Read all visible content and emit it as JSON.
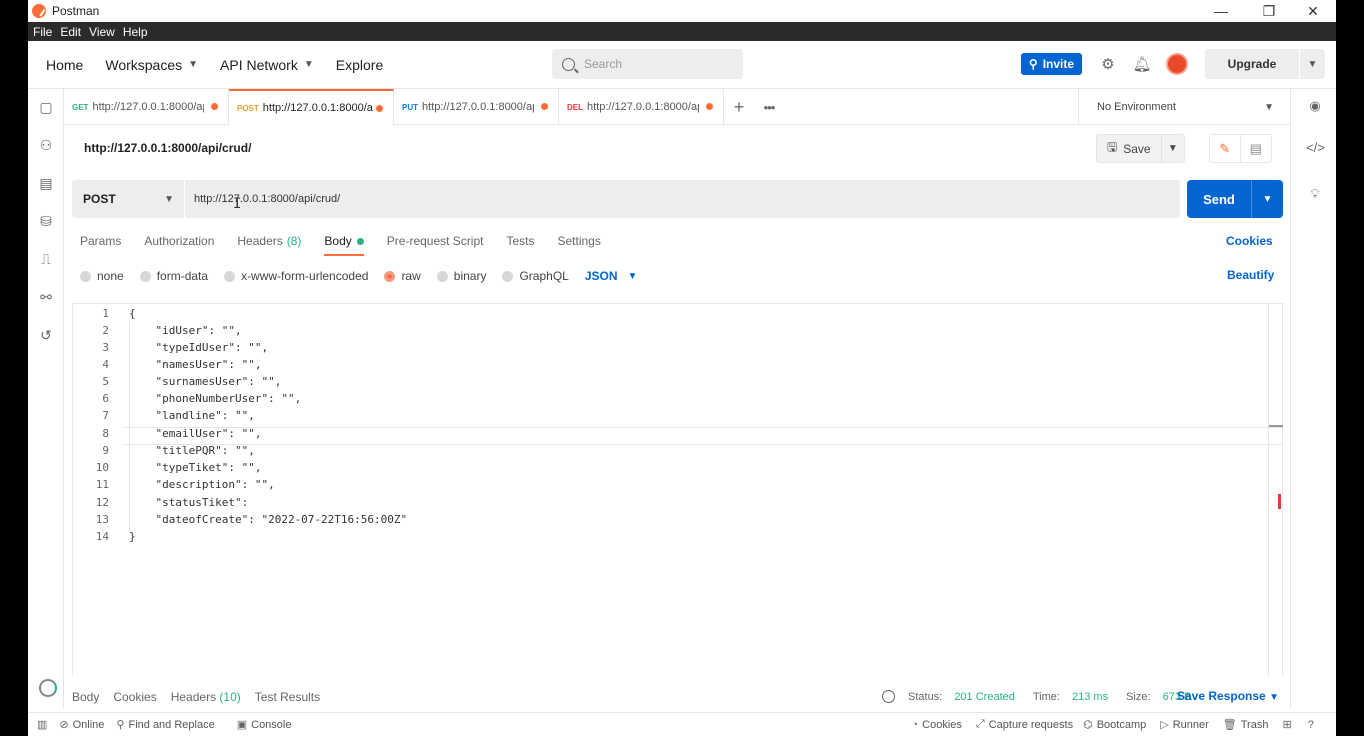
{
  "window": {
    "title": "Postman",
    "controls": {
      "minimize": "—",
      "restore": "❐",
      "close": "✕"
    }
  },
  "menu": [
    "File",
    "Edit",
    "View",
    "Help"
  ],
  "header": {
    "home": "Home",
    "workspaces": "Workspaces",
    "api_network": "API Network",
    "explore": "Explore",
    "search_placeholder": "Search",
    "invite": "Invite",
    "upgrade": "Upgrade"
  },
  "tabs": [
    {
      "method": "GET",
      "url": "http://127.0.0.1:8000/ap",
      "method_color": "#26b47f",
      "active": false
    },
    {
      "method": "POST",
      "url": "http://127.0.0.1:8000/a",
      "method_color": "#f0a030",
      "active": true
    },
    {
      "method": "PUT",
      "url": "http://127.0.0.1:8000/ap",
      "method_color": "#097bed",
      "active": false
    },
    {
      "method": "DEL",
      "url": "http://127.0.0.1:8000/ap",
      "method_color": "#e0383e",
      "active": false
    }
  ],
  "environment": "No Environment",
  "request": {
    "name": "http://127.0.0.1:8000/api/crud/",
    "save": "Save",
    "method": "POST",
    "url": "http://127.0.0.1:8000/api/crud/",
    "send": "Send"
  },
  "request_tabs": {
    "params": "Params",
    "authorization": "Authorization",
    "headers": "Headers",
    "headers_count": "(8)",
    "body": "Body",
    "prerequest": "Pre-request Script",
    "tests": "Tests",
    "settings": "Settings",
    "cookies": "Cookies"
  },
  "body_types": {
    "none": "none",
    "form_data": "form-data",
    "urlencoded": "x-www-form-urlencoded",
    "raw": "raw",
    "binary": "binary",
    "graphql": "GraphQL",
    "json": "JSON",
    "beautify": "Beautify"
  },
  "code": {
    "line_numbers": [
      "1",
      "2",
      "3",
      "4",
      "5",
      "6",
      "7",
      "8",
      "9",
      "10",
      "11",
      "12",
      "13",
      "14"
    ],
    "lines": [
      "{",
      "    \"idUser\": \"\",",
      "    \"typeIdUser\": \"\",",
      "    \"namesUser\": \"\",",
      "    \"surnamesUser\": \"\",",
      "    \"phoneNumberUser\": \"\",",
      "    \"landline\": \"\",",
      "    \"emailUser\": \"\",",
      "    \"titlePQR\": \"\",",
      "    \"typeTiket\": \"\",",
      "    \"description\": \"\",",
      "    \"statusTiket\": ",
      "    \"dateofCreate\": \"2022-07-22T16:56:00Z\"",
      "}"
    ]
  },
  "response": {
    "body": "Body",
    "cookies": "Cookies",
    "headers": "Headers",
    "headers_count": "(10)",
    "test_results": "Test Results",
    "status_label": "Status:",
    "status_value": "201 Created",
    "time_label": "Time:",
    "time_value": "213 ms",
    "size_label": "Size:",
    "size_value": "673 B",
    "save_response": "Save Response"
  },
  "footer": {
    "online": "Online",
    "find_replace": "Find and Replace",
    "console": "Console",
    "cookies": "Cookies",
    "capture": "Capture requests",
    "bootcamp": "Bootcamp",
    "runner": "Runner",
    "trash": "Trash"
  },
  "colors": {
    "accent": "#ff6c37",
    "primary": "#0265d2",
    "success": "#26b47f"
  }
}
